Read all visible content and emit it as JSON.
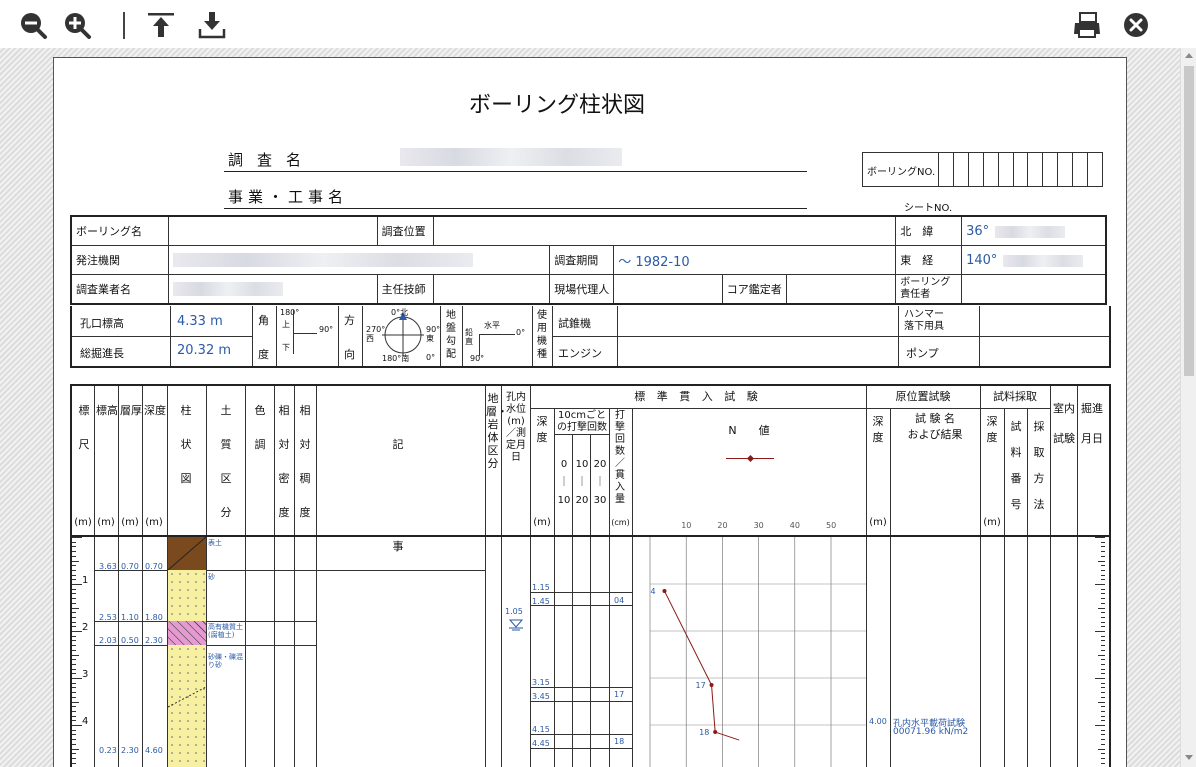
{
  "toolbar": {
    "zoom_out": "zoom-out-icon",
    "zoom_in": "zoom-in-icon",
    "upload": "upload-icon",
    "download": "download-icon",
    "print": "print-icon",
    "close": "close-icon"
  },
  "doc": {
    "title": "ボーリング柱状図",
    "survey_name_label": "調査名",
    "project_label": "事業・工事名",
    "boring_no_label": "ボーリングNO.",
    "sheet_no_label": "シートNO."
  },
  "info": {
    "boring_name_label": "ボーリング名",
    "location_label": "調査位置",
    "lat_label": "北　緯",
    "lat_value": "36°",
    "client_label": "発注機関",
    "period_label": "調査期間",
    "period_value": "～ 1982-10",
    "lon_label": "東　経",
    "lon_value": "140°",
    "company_label": "調査業者名",
    "engineer_label": "主任技師",
    "site_rep_label": "現場代理人",
    "core_label": "コア鑑定者",
    "boring_resp_label_1": "ボーリング",
    "boring_resp_label_2": "責任者",
    "elev_label": "孔口標高",
    "elev_value": "4.33 m",
    "angle_label_1": "角",
    "angle_label_2": "度",
    "angle_top": "180°",
    "angle_up": "上",
    "angle_down": "下",
    "angle_90": "90°",
    "dir_label_1": "方",
    "dir_label_2": "向",
    "compass_n": "0°北",
    "compass_w": "270°西",
    "compass_e": "90°東",
    "compass_s": "180°南",
    "compass_0": "0°",
    "slope_label": "地盤勾配",
    "slope_vert": "鉛直",
    "slope_horiz": "水平",
    "slope_0": "0°",
    "slope_90": "90°",
    "machine_label": "使用機種",
    "drill_label": "試錐機",
    "hammer_label_1": "ハンマー",
    "hammer_label_2": "落下用具",
    "depth_label": "総掘進長",
    "depth_value": "20.32 m",
    "engine_label": "エンジン",
    "pump_label": "ポンプ"
  },
  "log_header": {
    "scale": "標尺",
    "elevation": "標高",
    "thickness": "層厚",
    "depth": "深度",
    "column": "柱状図",
    "soil": "土質区分",
    "color": "色調",
    "density": "相対密度",
    "consistency": "相対稠度",
    "description": "記事",
    "geology": "地層・岩体区分",
    "water": "孔内水位(m)／測定月日",
    "spt_title": "標 準 貫 入 試 験",
    "spt_depth": "深度",
    "spt_blows": "10cmごとの打撃回数",
    "spt_b1": "0｜10",
    "spt_b2": "10｜20",
    "spt_b3": "20｜30",
    "spt_count": "打撃回数／貫入量",
    "spt_cm": "(cm)",
    "n_value": "N　　値",
    "n_ticks": [
      "10",
      "20",
      "30",
      "40",
      "50"
    ],
    "insitu_title": "原位置試験",
    "insitu_depth": "深度",
    "insitu_name": "試 験 名",
    "insitu_result": "および結果",
    "sample_title": "試料採取",
    "sample_depth": "深度",
    "sample_no": "試料番号",
    "sample_method": "採取方法",
    "lab": "室内試験",
    "date": "掘進月日",
    "unit_m": "(m)"
  },
  "log_rows": {
    "scale_marks": [
      "1",
      "2",
      "3",
      "4"
    ],
    "elev": [
      "3.63",
      "2.53",
      "2.03",
      "0.23"
    ],
    "thick": [
      "0.70",
      "1.10",
      "0.50",
      "2.30"
    ],
    "depth": [
      "0.70",
      "1.80",
      "2.30",
      "4.60"
    ],
    "soil": [
      "表土",
      "砂",
      "高有機質土(腐植土)",
      "砂礫・礫混り砂"
    ],
    "water_level": "1.05",
    "spt_depths": [
      "1.15",
      "1.45",
      "3.15",
      "3.45",
      "4.15",
      "4.45"
    ],
    "spt_counts": [
      "04",
      "17",
      "18"
    ],
    "insitu_depth": "4.00",
    "insitu_name": "孔内水平載荷試験",
    "insitu_value": "00071.96 kN/m2"
  },
  "chart_data": {
    "type": "scatter",
    "x_label": "N値",
    "xlim": [
      0,
      60
    ],
    "x_ticks": [
      10,
      20,
      30,
      40,
      50
    ],
    "y_label": "深度 (m)",
    "points": [
      {
        "depth": 1.15,
        "n": 4
      },
      {
        "depth": 3.15,
        "n": 17
      },
      {
        "depth": 4.15,
        "n": 18
      }
    ],
    "point_labels": [
      "4",
      "17",
      "18"
    ],
    "line": true,
    "color": "#8b1a1a"
  }
}
